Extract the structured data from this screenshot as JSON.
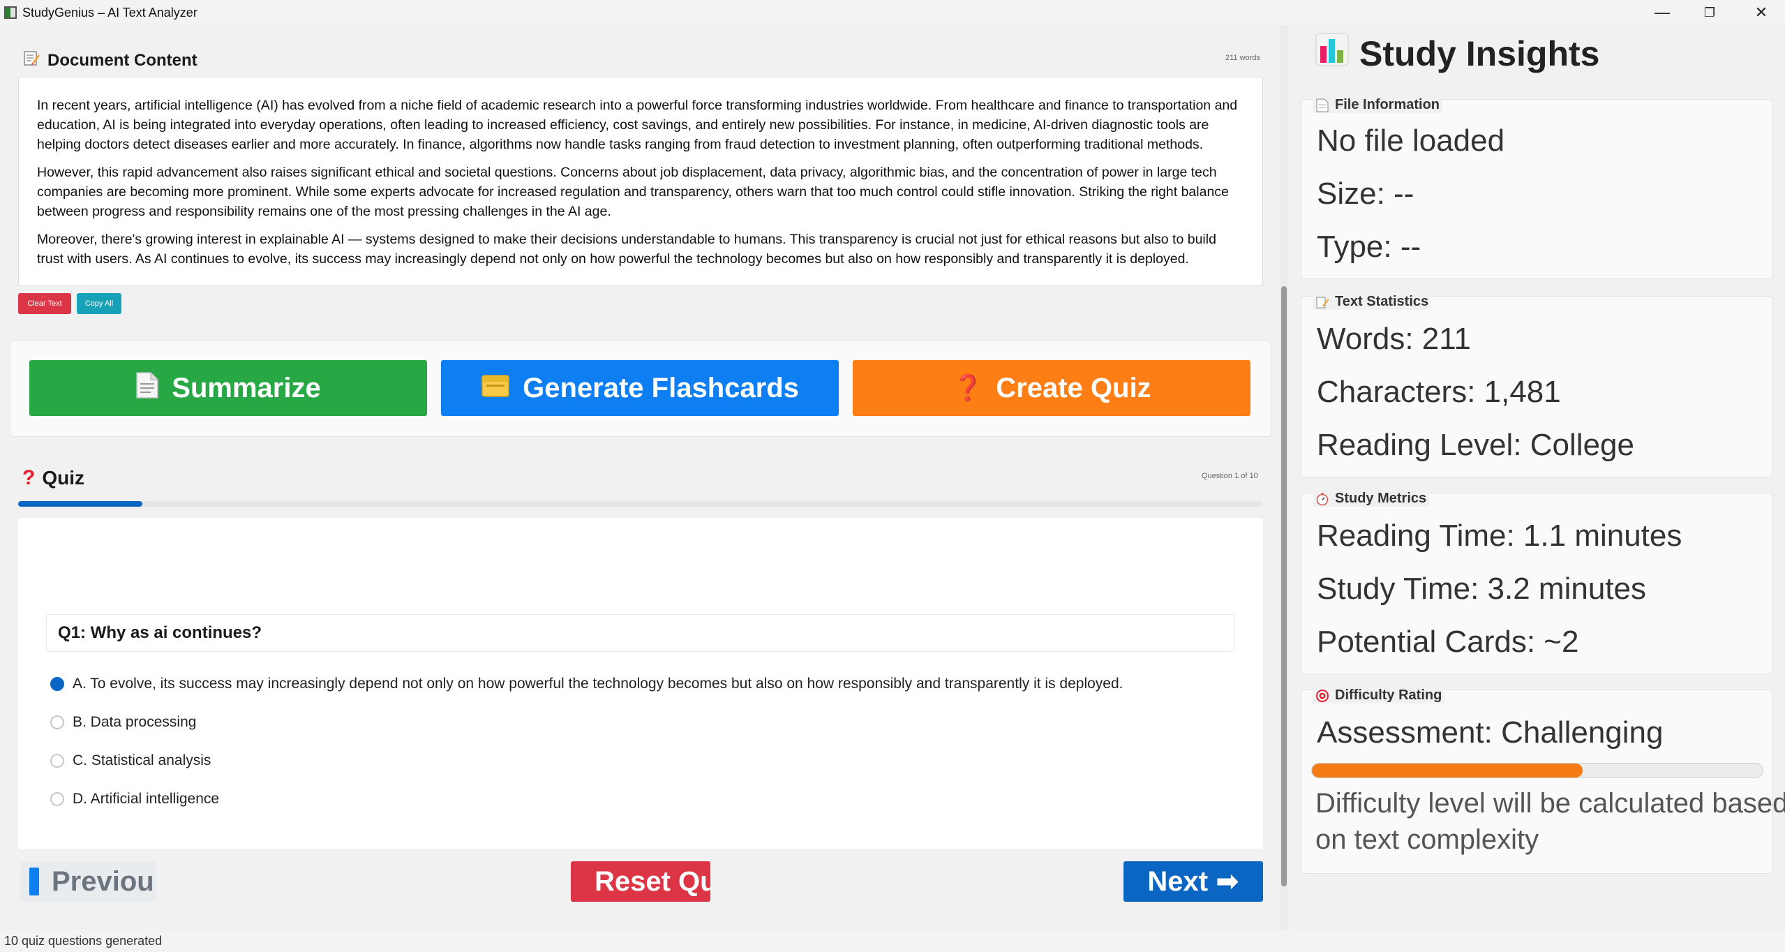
{
  "window": {
    "title": "StudyGenius – AI Text Analyzer",
    "minimize": "—",
    "maximize": "❐",
    "close": "✕"
  },
  "document": {
    "header": "Document Content",
    "word_count": "211 words",
    "paragraphs": [
      "In recent years, artificial intelligence (AI) has evolved from a niche field of academic research into a powerful force transforming industries worldwide. From healthcare and finance to transportation and education, AI is being integrated into everyday operations, often leading to increased efficiency, cost savings, and entirely new possibilities. For instance, in medicine, AI-driven diagnostic tools are helping doctors detect diseases earlier and more accurately. In finance, algorithms now handle tasks ranging from fraud detection to investment planning, often outperforming traditional methods.",
      "However, this rapid advancement also raises significant ethical and societal questions. Concerns about job displacement, data privacy, algorithmic bias, and the concentration of power in large tech companies are becoming more prominent. While some experts advocate for increased regulation and transparency, others warn that too much control could stifle innovation. Striking the right balance between progress and responsibility remains one of the most pressing challenges in the AI age.",
      "Moreover, there's growing interest in explainable AI — systems designed to make their decisions understandable to humans. This transparency is crucial not just for ethical reasons but also to build trust with users. As AI continues to evolve, its success may increasingly depend not only on how powerful the technology becomes but also on how responsibly and transparently it is deployed."
    ],
    "clear_label": "Clear Text",
    "copy_label": "Copy All"
  },
  "actions": {
    "summarize": "Summarize",
    "flashcards": "Generate Flashcards",
    "quiz": "Create Quiz",
    "summarize_icon": "document-icon",
    "flashcards_icon": "card-box-icon",
    "quiz_icon": "question-mark-icon"
  },
  "quiz": {
    "header": "Quiz",
    "counter": "Question 1 of 10",
    "progress_fraction": 0.1,
    "question": "Q1: Why as ai continues?",
    "options": [
      {
        "label": "A. To evolve, its success may increasingly depend not only on how powerful the technology becomes but also on how responsibly and transparently it is deployed.",
        "selected": true
      },
      {
        "label": "B. Data processing",
        "selected": false
      },
      {
        "label": "C. Statistical analysis",
        "selected": false
      },
      {
        "label": "D. Artificial intelligence",
        "selected": false
      }
    ],
    "prev_label": "Previou",
    "reset_label": "Reset Qu",
    "next_label": "Next ➡"
  },
  "status": "10 quiz questions generated",
  "insights": {
    "title": "Study Insights",
    "file_info": {
      "title": "File Information",
      "name": "No file loaded",
      "size": "Size: --",
      "type": "Type: --"
    },
    "text_stats": {
      "title": "Text Statistics",
      "words": "Words: 211",
      "characters": "Characters: 1,481",
      "reading_level": "Reading Level: College"
    },
    "study_metrics": {
      "title": "Study Metrics",
      "reading_time": "Reading Time: 1.1 minutes",
      "study_time": "Study Time: 3.2 minutes",
      "potential_cards": "Potential Cards: ~2"
    },
    "difficulty": {
      "title": "Difficulty Rating",
      "assessment": "Assessment: Challenging",
      "level_fraction": 0.6,
      "note_line1": "Difficulty level will be calculated based",
      "note_line2": "on text complexity"
    }
  },
  "colors": {
    "summarize": "#28a745",
    "flashcards": "#0d7ff2",
    "quiz": "#fd7e14",
    "clear": "#dc3545",
    "copy": "#17a2b8",
    "reset": "#dc3545",
    "next": "#0a66c2",
    "difficulty": "#f57c14"
  }
}
